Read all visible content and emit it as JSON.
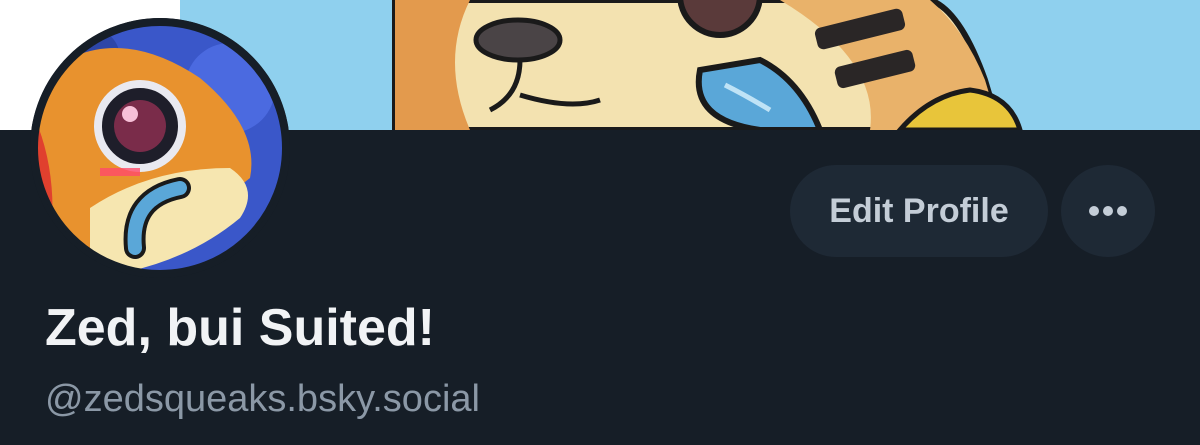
{
  "banner": {
    "icon": "cartoon-dog-mascot-illustration"
  },
  "avatar": {
    "icon": "cartoon-dog-face-avatar"
  },
  "actions": {
    "edit_profile_label": "Edit Profile",
    "more_icon": "ellipsis-icon"
  },
  "profile": {
    "display_name": "Zed, bui Suited!",
    "handle": "@zedsqueaks.bsky.social"
  },
  "colors": {
    "background": "#161e27",
    "button_bg": "#1e2935",
    "banner_sky": "#8fd0ee"
  }
}
